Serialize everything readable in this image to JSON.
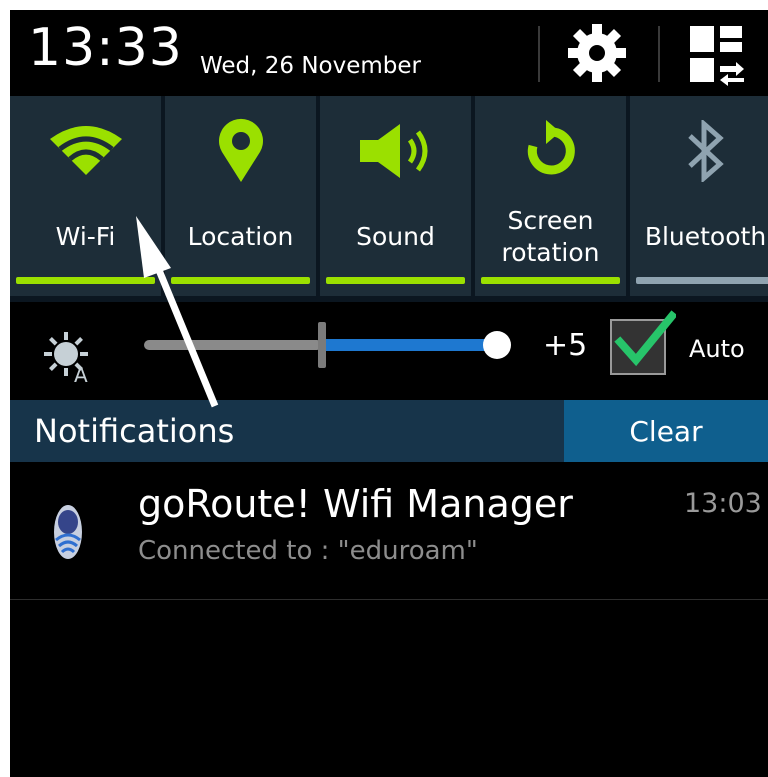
{
  "status": {
    "time": "13:33",
    "date": "Wed, 26 November"
  },
  "header_icons": [
    "gear-icon",
    "quick-settings-edit-icon"
  ],
  "quick_settings": [
    {
      "label": "Wi-Fi",
      "icon": "wifi-icon",
      "active": true
    },
    {
      "label": "Location",
      "icon": "location-pin-icon",
      "active": true
    },
    {
      "label": "Sound",
      "icon": "speaker-icon",
      "active": true
    },
    {
      "label": "Screen\nrotation",
      "icon": "rotation-icon",
      "active": true
    },
    {
      "label": "Bluetooth",
      "icon": "bluetooth-icon",
      "active": false
    }
  ],
  "brightness": {
    "level_label": "+5",
    "auto_label": "Auto",
    "auto_checked": true
  },
  "notifications": {
    "title": "Notifications",
    "clear_label": "Clear"
  },
  "notification_items": [
    {
      "app": "goRoute! Wifi Manager",
      "text": "Connected to : \"eduroam\"",
      "time": "13:03"
    }
  ],
  "colors": {
    "accent_active": "#9be000",
    "inactive": "#8fa3b0",
    "slider_blue": "#1e78d0",
    "notif_bar": "#17344a",
    "clear_btn": "#0f5f8e"
  }
}
